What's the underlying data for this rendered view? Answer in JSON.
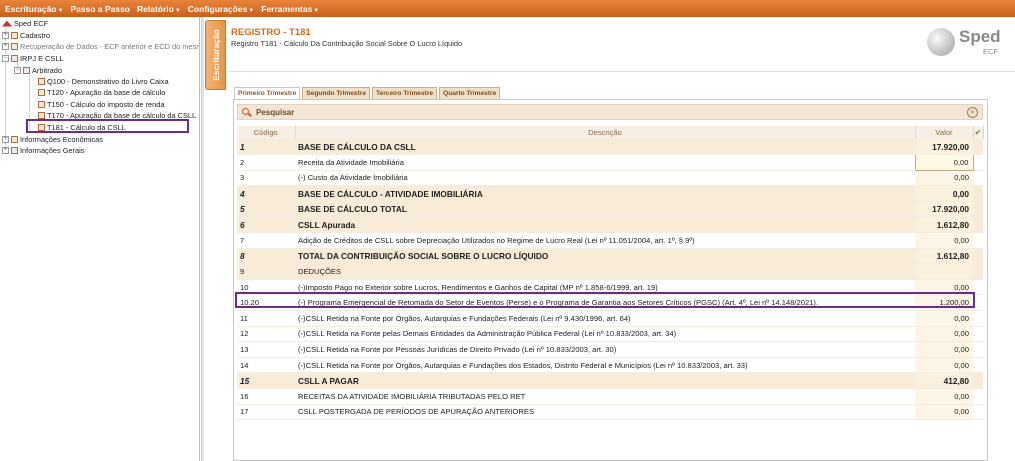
{
  "menu": [
    {
      "label": "Escrituração",
      "caret": true
    },
    {
      "label": "Passo a Passo",
      "caret": false
    },
    {
      "label": "Relatório",
      "caret": true
    },
    {
      "label": "Configurações",
      "caret": true
    },
    {
      "label": "Ferramentas",
      "caret": true
    }
  ],
  "tree": {
    "root": "Sped ECF",
    "cadastro": "Cadastro",
    "recuperacao": "Recuperação de Dados - ECF anterior e ECD do mesmo",
    "irpj": "IRPJ E CSLL",
    "arbitrado": "Arbitrado",
    "q100": "Q100 - Demonstrativo do Livro Caixa",
    "t120": "T120 - Apuração da base de cálculo",
    "t150": "T150 - Cálculo do imposto de renda",
    "t170": "T170 - Apuração da base de cálculo da CSLL",
    "t181": "T181 - Cálculo da CSLL",
    "info_econ": "Informações Econômicas",
    "info_gerais": "Informações Gerais"
  },
  "side_tab": "Escrituração",
  "header": {
    "title": "REGISTRO - T181",
    "subtitle": "Registro T181 - Cálculo Da Contribuição Social Sobre O Lucro Líquido"
  },
  "logo": {
    "word": "Sped",
    "sub": "ECF"
  },
  "tabs": [
    "Primeiro Trimestre",
    "Segundo Trimestre",
    "Terceiro Trimestre",
    "Quarto Trimestre"
  ],
  "search": {
    "label": "Pesquisar"
  },
  "table": {
    "headers": {
      "codigo": "Código",
      "descricao": "Descrição",
      "valor": "Valor"
    },
    "rows": [
      {
        "codigo": "1",
        "descricao": "BASE DE CÁLCULO DA CSLL",
        "valor": "17.920,00"
      },
      {
        "codigo": "2",
        "descricao": "Receita da Atividade Imobiliária",
        "valor": "0,00"
      },
      {
        "codigo": "3",
        "descricao": "(-) Custo da Atividade Imobiliária",
        "valor": "0,00"
      },
      {
        "codigo": "4",
        "descricao": "BASE DE CÁLCULO - ATIVIDADE IMOBILIÁRIA",
        "valor": "0,00"
      },
      {
        "codigo": "5",
        "descricao": "BASE DE CÁLCULO TOTAL",
        "valor": "17.920,00"
      },
      {
        "codigo": "6",
        "descricao": "CSLL Apurada",
        "valor": "1.612,80"
      },
      {
        "codigo": "7",
        "descricao": "Adição de Créditos de CSLL sobre Depreciação Utilizados no Regime de Lucro Real (Lei nº 11.051/2004, art. 1º, § 9º)",
        "valor": "0,00"
      },
      {
        "codigo": "8",
        "descricao": "TOTAL DA CONTRIBUIÇÃO SOCIAL SOBRE O LUCRO LÍQUIDO",
        "valor": "1.612,80"
      },
      {
        "codigo": "9",
        "descricao": "DEDUÇÕES",
        "valor": ""
      },
      {
        "codigo": "10",
        "descricao": "(-)Imposto Pago no Exterior sobre Lucros, Rendimentos e Ganhos de Capital (MP nº 1.858-6/1999, art. 19)",
        "valor": "0,00"
      },
      {
        "codigo": "10.20",
        "descricao": "(-) Programa Emergencial de Retomada do Setor de Eventos (Perse) e o Programa de Garantia aos Setores Críticos (PGSC) (Art. 4º, Lei nº 14.148/2021).",
        "valor": "1.200,00"
      },
      {
        "codigo": "11",
        "descricao": "(-)CSLL Retida na Fonte por Órgãos, Autarquias e Fundações Federais (Lei nº 9.430/1996, art. 64)",
        "valor": "0,00"
      },
      {
        "codigo": "12",
        "descricao": "(-)CSLL Retida na Fonte pelas Demais Entidades da Administração Pública Federal (Lei nº 10.833/2003, art. 34)",
        "valor": "0,00"
      },
      {
        "codigo": "13",
        "descricao": "(-)CSLL Retida na Fonte por Pessoas Jurídicas de Direito Privado (Lei nº 10.833/2003, art. 30)",
        "valor": "0,00"
      },
      {
        "codigo": "14",
        "descricao": "(-)CSLL Retida na Fonte por Órgãos, Autarquias e Fundações dos Estados, Distrito Federal e Municípios (Lei nº 10.833/2003, art. 33)",
        "valor": "0,00"
      },
      {
        "codigo": "15",
        "descricao": "CSLL A PAGAR",
        "valor": "412,80"
      },
      {
        "codigo": "16",
        "descricao": "RECEITAS DA ATIVIDADE IMOBILIÁRIA TRIBUTADAS PELO RET",
        "valor": "0,00"
      },
      {
        "codigo": "17",
        "descricao": "CSLL POSTERGADA DE PERÍODOS DE APURAÇÃO ANTERIORES",
        "valor": "0,00"
      }
    ]
  },
  "colors": {
    "accent": "#d9711f",
    "highlight": "#6a2c91"
  }
}
